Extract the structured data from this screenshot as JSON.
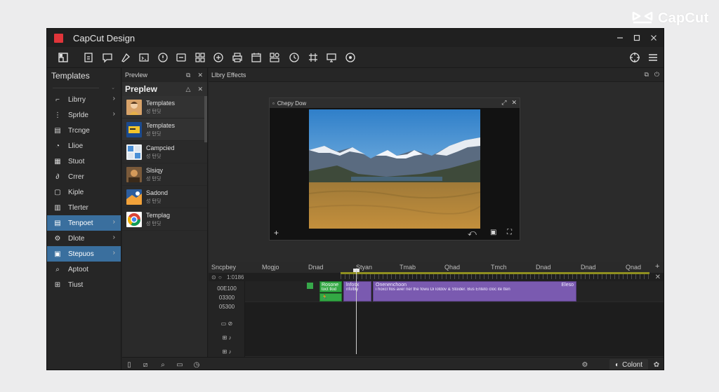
{
  "brand": {
    "name": "CapCut"
  },
  "window": {
    "title": "CapCut Design"
  },
  "toolbar": {
    "tools": [
      "import-icon",
      "file-icon",
      "comment-icon",
      "brush-icon",
      "code-icon",
      "info-icon",
      "text-edit-icon",
      "layout-icon",
      "sticker-icon",
      "print-icon",
      "calendar-icon",
      "share-icon",
      "clock-icon",
      "grid-icon",
      "monitor-icon",
      "play-circle-icon"
    ],
    "right_tools": [
      "target-icon",
      "menu-icon"
    ]
  },
  "sidebar": {
    "title": "Templates",
    "items": [
      {
        "label": "Librry",
        "icon": "cursor-icon",
        "chevron": true,
        "active": false
      },
      {
        "label": "Sprlde",
        "icon": "dots-icon",
        "chevron": true,
        "active": false
      },
      {
        "label": "Trcnge",
        "icon": "layers-icon",
        "chevron": false,
        "active": false
      },
      {
        "label": "Llioe",
        "icon": "shapes-icon",
        "chevron": false,
        "active": false
      },
      {
        "label": "Stuot",
        "icon": "sticker-icon",
        "chevron": false,
        "active": false
      },
      {
        "label": "Crrer",
        "icon": "link-icon",
        "chevron": false,
        "active": false
      },
      {
        "label": "Kiple",
        "icon": "frame-icon",
        "chevron": false,
        "active": false
      },
      {
        "label": "Tlerter",
        "icon": "page-icon",
        "chevron": false,
        "active": false
      },
      {
        "label": "Tenpoet",
        "icon": "template-icon",
        "chevron": true,
        "active": true
      },
      {
        "label": "Dlote",
        "icon": "gear-icon",
        "chevron": true,
        "active": false
      },
      {
        "label": "Stepuos",
        "icon": "box-icon",
        "chevron": true,
        "active": true
      },
      {
        "label": "Aptoot",
        "icon": "search-icon",
        "chevron": false,
        "active": false
      },
      {
        "label": "Tiust",
        "icon": "tree-icon",
        "chevron": false,
        "active": false
      }
    ]
  },
  "template_panel": {
    "header1": "Prevlew",
    "header2": "Preplew",
    "items": [
      {
        "title": "Templates",
        "sub": "성 턴딧",
        "thumb": "person",
        "selected": true
      },
      {
        "title": "Templates",
        "sub": "성 턴딧",
        "thumb": "yellow",
        "selected": true
      },
      {
        "title": "Campcied",
        "sub": "성 턴딧",
        "thumb": "grid",
        "selected": false
      },
      {
        "title": "Slsiqy",
        "sub": "성 턴딧",
        "thumb": "photo",
        "selected": false
      },
      {
        "title": "Sadond",
        "sub": "성 턴딧",
        "thumb": "colorful",
        "selected": false
      },
      {
        "title": "Templag",
        "sub": "성 턴딧",
        "thumb": "chrome",
        "selected": false
      }
    ]
  },
  "viewer": {
    "title": "Llbry Effects",
    "player_title": "Chepy Dow"
  },
  "timeline": {
    "ruler": [
      "Sncpbey",
      "Mogjo",
      "Dnad",
      "Styan",
      "Tmab",
      "Qhad",
      "Tmch",
      "Dnad",
      "Dnad",
      "Qnad"
    ],
    "sub_time": "1:0186",
    "rows": [
      "00E100",
      "03300",
      "05300"
    ],
    "clips": {
      "green_top": "Rosone",
      "green_bottom": "toct tlod",
      "purple_left": "lnfosx",
      "purple_left_sub": "nfolbly",
      "purple_main": "Onenenchoon",
      "purple_main_sub": "i hoxcl flos aver ner the fowu Di lotdov & Stoider. Bus Enteto cloc ite tten",
      "purple_right": "Eleso"
    }
  },
  "statusbar": {
    "color_label": "Colont"
  }
}
